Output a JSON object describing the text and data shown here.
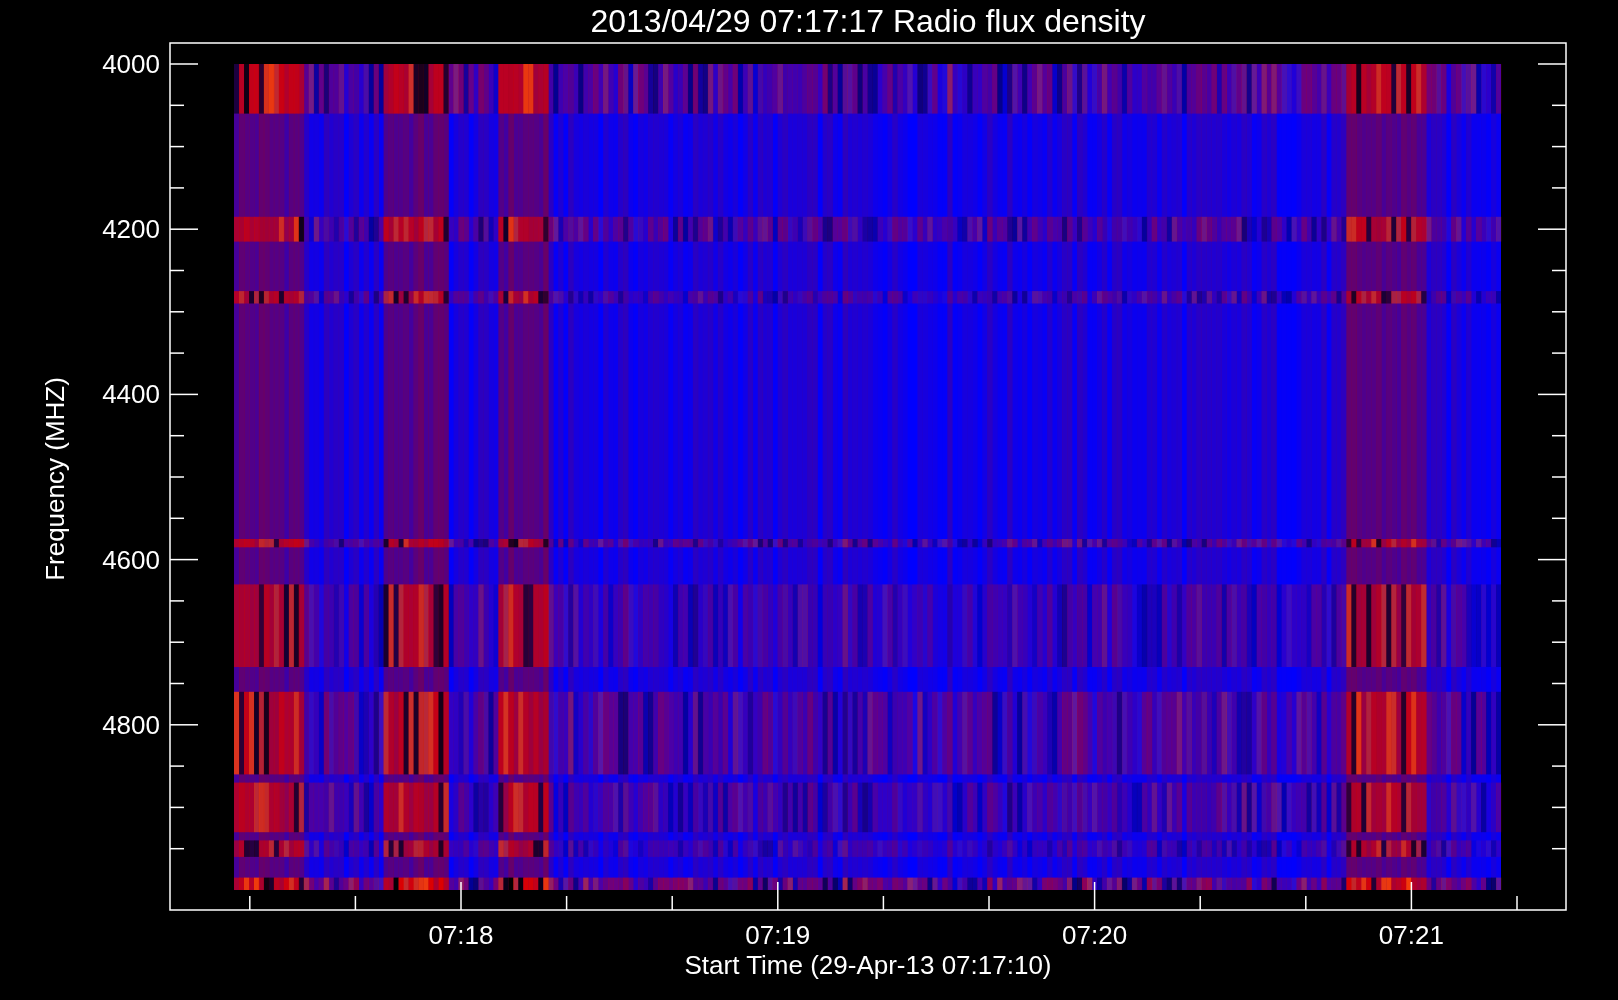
{
  "plot": {
    "title": "2013/04/29 07:17:17 Radio flux density",
    "ylabel": "Frequency (MHZ)",
    "xlabel": "Start Time (29-Apr-13 07:17:10)",
    "yticks": [
      "4000",
      "4200",
      "4400",
      "4600",
      "4800"
    ],
    "xticks": [
      "07:18",
      "07:19",
      "07:20",
      "07:21"
    ]
  }
}
